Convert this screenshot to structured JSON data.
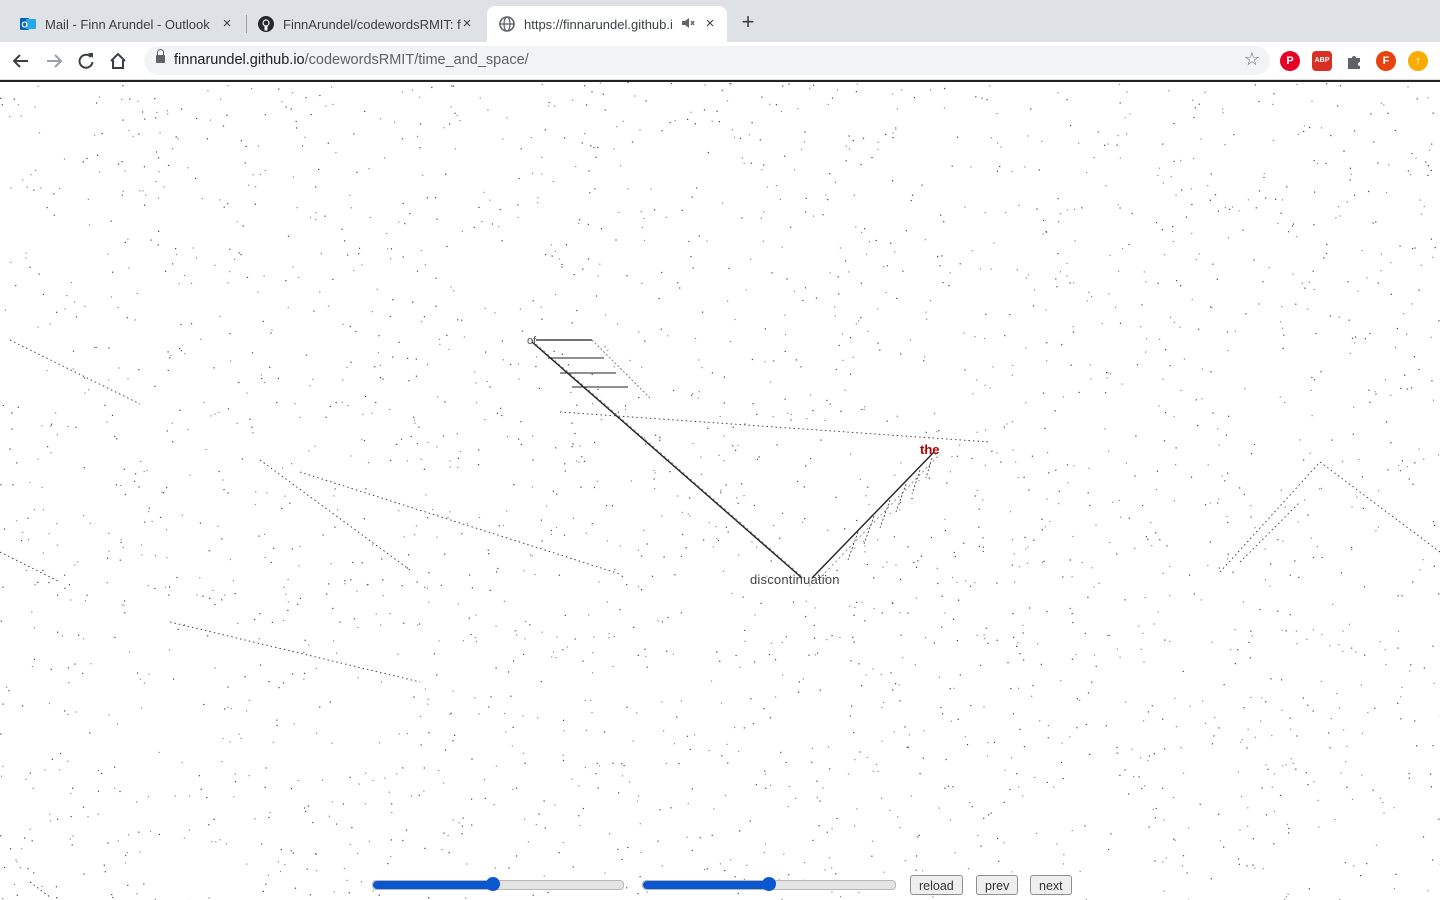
{
  "browser": {
    "tabs": [
      {
        "title": "Mail - Finn Arundel - Outlook",
        "icon": "outlook-icon",
        "active": false
      },
      {
        "title": "FinnArundel/codewordsRMIT: f",
        "icon": "github-icon",
        "active": false
      },
      {
        "title": "https://finnarundel.github.i",
        "icon": "globe-icon",
        "active": true,
        "muted_icon": "speaker-muted-icon"
      }
    ],
    "new_tab_label": "+",
    "close_glyph": "×",
    "address": {
      "host": "finnarundel.github.io",
      "path": "/codewordsRMIT/time_and_space/"
    },
    "extensions": [
      {
        "name": "pinterest-icon",
        "color": "#e60023",
        "glyph": "P"
      },
      {
        "name": "adblock-icon",
        "color": "#d93025",
        "glyph": "ABP"
      },
      {
        "name": "puzzle-icon",
        "color": "#5f6368",
        "glyph": ""
      },
      {
        "name": "profile-avatar",
        "color": "#e8430e",
        "glyph": "F"
      },
      {
        "name": "update-icon",
        "color": "#f9ab00",
        "glyph": "↑"
      }
    ]
  },
  "page": {
    "canvas_words": [
      {
        "text": "of",
        "color": "#555555"
      },
      {
        "text": "discontinuation",
        "color": "#444444"
      },
      {
        "text": "the",
        "color": "#b00000"
      }
    ],
    "controls": {
      "slider1": {
        "value": 0.48
      },
      "slider2": {
        "value": 0.5
      },
      "reload_label": "reload",
      "prev_label": "prev",
      "next_label": "next"
    },
    "colors": {
      "accent": "#0b57d0"
    }
  }
}
